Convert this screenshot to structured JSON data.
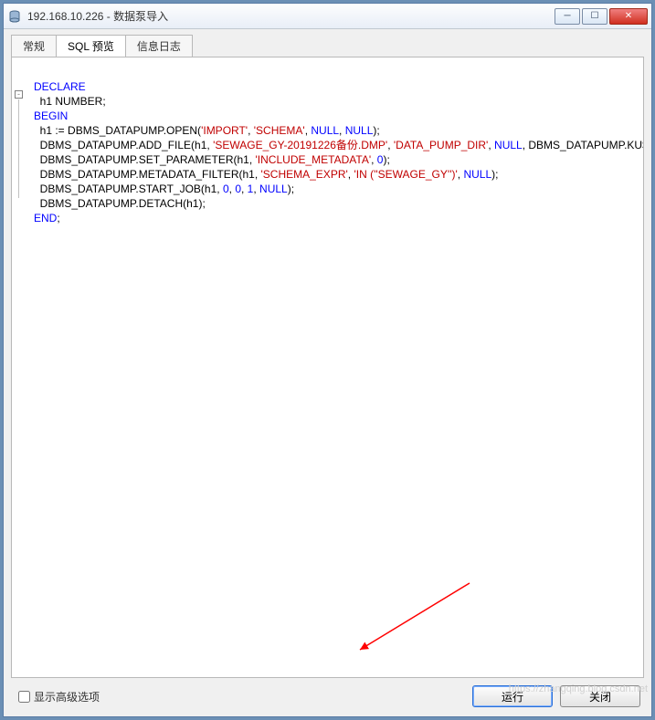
{
  "window": {
    "title": "192.168.10.226 - 数据泵导入",
    "icon": "database-icon"
  },
  "winbuttons": {
    "min": "─",
    "max": "☐",
    "close": "✕"
  },
  "tabs": [
    {
      "label": "常规",
      "active": false
    },
    {
      "label": "SQL 预览",
      "active": true
    },
    {
      "label": "信息日志",
      "active": false
    }
  ],
  "code": {
    "l1_kw": "DECLARE",
    "l2": "  h1 NUMBER;",
    "l3_kw": "BEGIN",
    "l4_a": "  h1 := DBMS_DATAPUMP.OPEN(",
    "l4_s1": "'IMPORT'",
    "l4_s2": "'SCHEMA'",
    "l4_n": "NULL",
    "l4_end": ");",
    "l5_a": "  DBMS_DATAPUMP.ADD_FILE(h1, ",
    "l5_s1": "'SEWAGE_GY-20191226备份.DMP'",
    "l5_s2": "'DATA_PUMP_DIR'",
    "l5_n": "NULL",
    "l5b": "DBMS_DATAPUMP.KU$_FILE_TYPE_DUMP_FILE);",
    "l6_a": "  DBMS_DATAPUMP.SET_PARAMETER(h1, ",
    "l6_s1": "'INCLUDE_METADATA'",
    "l6_num": "0",
    "l6_end": ");",
    "l7_a": "  DBMS_DATAPUMP.METADATA_FILTER(h1, ",
    "l7_s1": "'SCHEMA_EXPR'",
    "l7_s2": "'IN (''SEWAGE_GY'')'",
    "l7_n": "NULL",
    "l7_end": ");",
    "l8_a": "  DBMS_DATAPUMP.START_JOB(h1, ",
    "l8_n1": "0",
    "l8_n2": "0",
    "l8_n3": "1",
    "l8_null": "NULL",
    "l8_end": ");",
    "l9": "  DBMS_DATAPUMP.DETACH(h1);",
    "l10_kw": "END",
    "l10_end": ";"
  },
  "bottom": {
    "advanced": "显示高级选项",
    "run": "运行",
    "close": "关闭"
  },
  "watermark": "https://zhangqing.blog.csdn.net"
}
